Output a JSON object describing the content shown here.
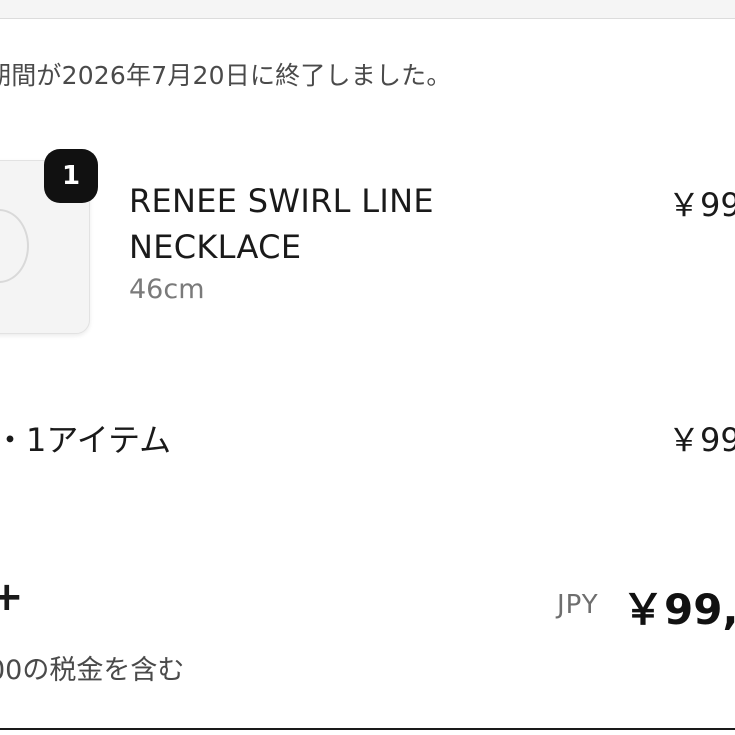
{
  "notice": "期間が2026年7月20日に終了しました。",
  "item": {
    "quantity": "1",
    "name": "RENEE SWIRL LINE NECKLACE",
    "variant": "46cm",
    "price": "￥99"
  },
  "subtotal": {
    "label": "・1アイテム",
    "value": "￥99"
  },
  "total": {
    "label": "+",
    "currency": "JPY",
    "value": "￥99,"
  },
  "tax_note": "00の税金を含む"
}
